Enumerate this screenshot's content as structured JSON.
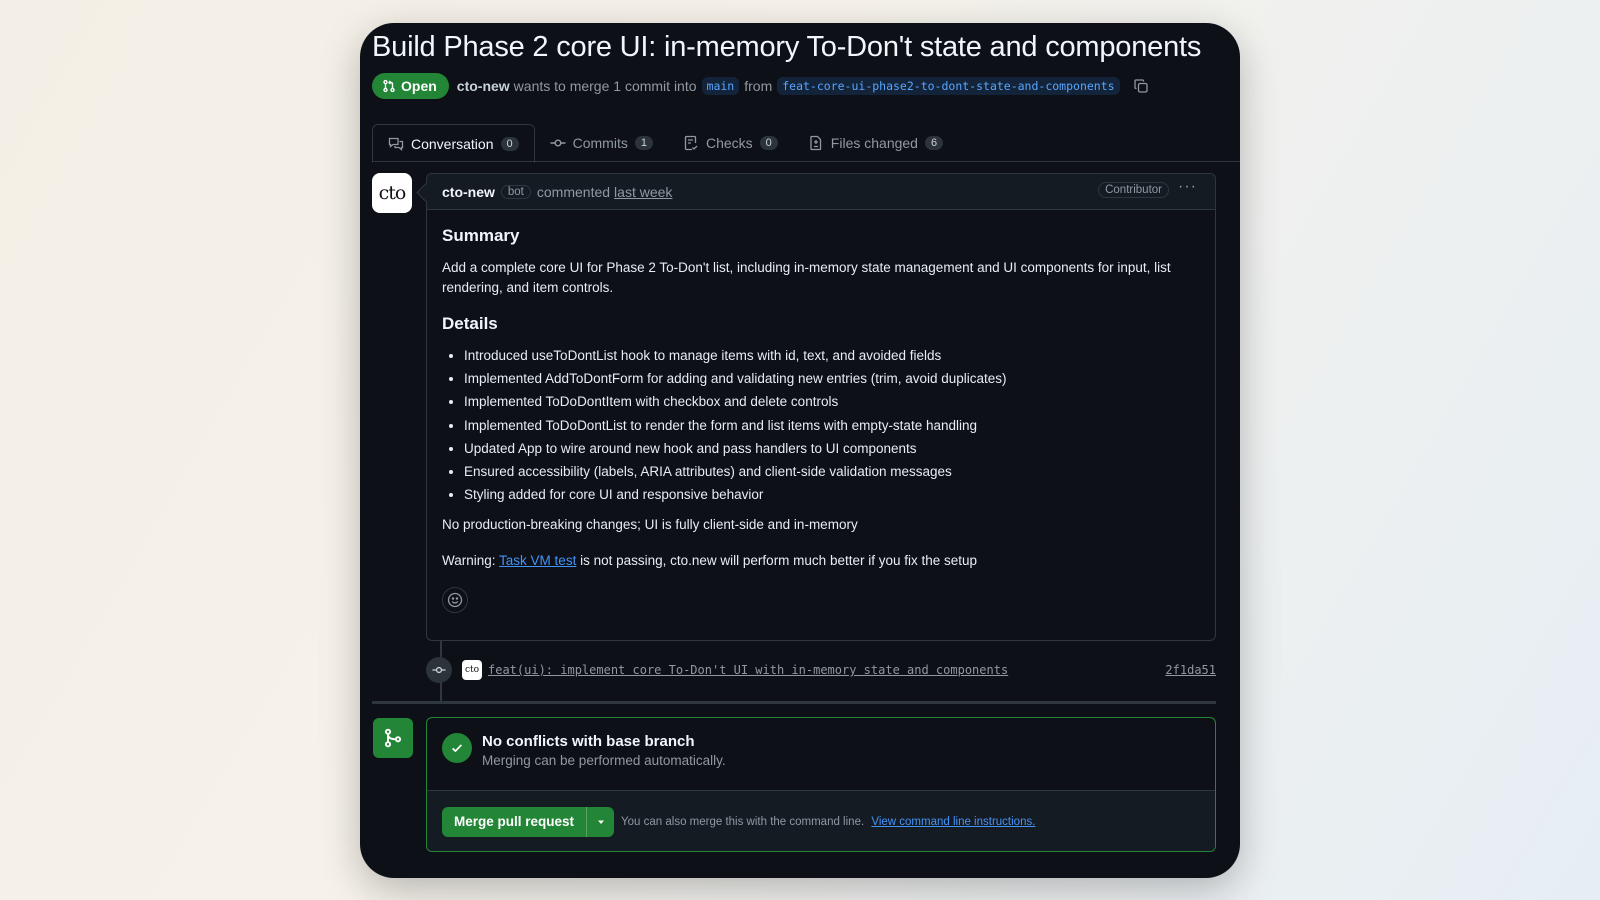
{
  "pr": {
    "title": "Build Phase 2 core UI: in-memory To-Don't state and components",
    "state": "Open",
    "author": "cto-new",
    "merge_text": "wants to merge 1 commit into",
    "base_branch": "main",
    "from_text": "from",
    "head_branch": "feat-core-ui-phase2-to-dont-state-and-components"
  },
  "tabs": [
    {
      "label": "Conversation",
      "count": "0",
      "icon": "comment-discussion-icon"
    },
    {
      "label": "Commits",
      "count": "1",
      "icon": "git-commit-icon"
    },
    {
      "label": "Checks",
      "count": "0",
      "icon": "checklist-icon"
    },
    {
      "label": "Files changed",
      "count": "6",
      "icon": "file-diff-icon"
    }
  ],
  "comment": {
    "avatar_text": "cto",
    "author": "cto-new",
    "bot_label": "bot",
    "action": "commented",
    "time": "last week",
    "role": "Contributor",
    "summary_heading": "Summary",
    "summary_text": "Add a complete core UI for Phase 2 To-Don't list, including in-memory state management and UI components for input, list rendering, and item controls.",
    "details_heading": "Details",
    "details": [
      "Introduced useToDontList hook to manage items with id, text, and avoided fields",
      "Implemented AddToDontForm for adding and validating new entries (trim, avoid duplicates)",
      "Implemented ToDoDontItem with checkbox and delete controls",
      "Implemented ToDoDontList to render the form and list items with empty-state handling",
      "Updated App to wire around new hook and pass handlers to UI components",
      "Ensured accessibility (labels, ARIA attributes) and client-side validation messages",
      "Styling added for core UI and responsive behavior"
    ],
    "note": "No production-breaking changes; UI is fully client-side and in-memory",
    "warning_prefix": "Warning:",
    "warning_link": "Task VM test",
    "warning_suffix": "is not passing, cto.new will perform much better if you fix the setup"
  },
  "commit": {
    "avatar_text": "cto",
    "message": "feat(ui): implement core To-Don't UI with in-memory state and components",
    "sha": "2f1da51"
  },
  "merge": {
    "status_title": "No conflicts with base branch",
    "status_sub": "Merging can be performed automatically.",
    "button_label": "Merge pull request",
    "note": "You can also merge this with the command line.",
    "note_link": "View command line instructions."
  },
  "colors": {
    "background": "#0d1117",
    "green": "#238636",
    "link": "#4493f8",
    "border": "#30363d"
  }
}
